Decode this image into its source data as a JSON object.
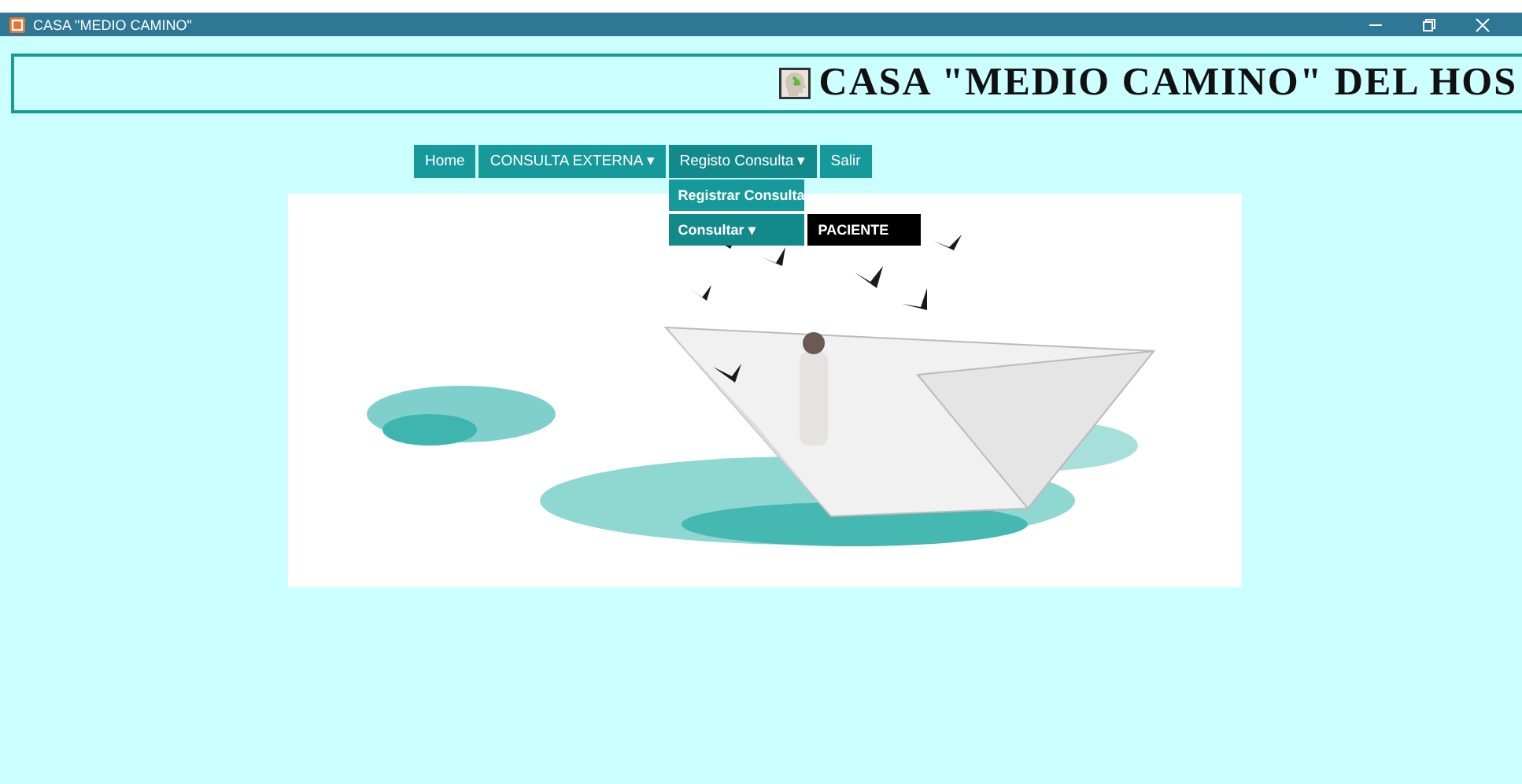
{
  "window": {
    "title": "CASA \"MEDIO CAMINO\""
  },
  "header": {
    "title": "CASA \"MEDIO CAMINO\" DEL HOS"
  },
  "menu": [
    {
      "label": "Home"
    },
    {
      "label": "CONSULTA EXTERNA",
      "caret": "▾"
    },
    {
      "label": "Registo Consulta",
      "caret": "▾",
      "expanded": true,
      "children": [
        {
          "label": "Registrar Consulta"
        },
        {
          "label": "Consultar",
          "caret": "▾",
          "expanded": true,
          "children": [
            {
              "label": "PACIENTE"
            }
          ]
        }
      ]
    },
    {
      "label": "Salir"
    }
  ]
}
